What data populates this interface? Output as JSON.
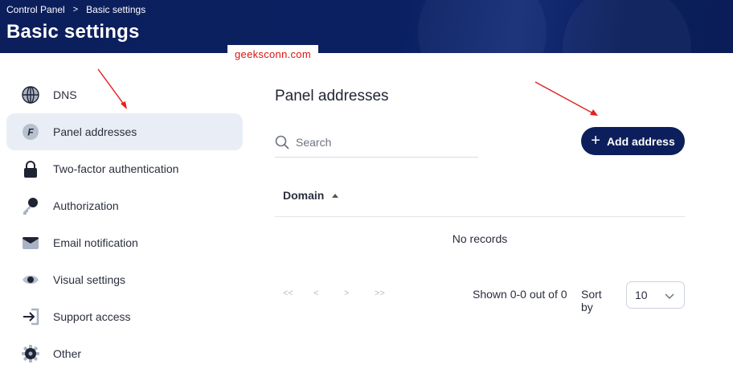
{
  "header": {
    "breadcrumb": [
      "Control Panel",
      "Basic settings"
    ],
    "breadcrumb_separator": ">",
    "title": "Basic settings"
  },
  "watermark": "geeksconn.com",
  "sidebar": {
    "items": [
      {
        "label": "DNS",
        "icon": "globe-icon"
      },
      {
        "label": "Panel addresses",
        "icon": "panel-f-icon",
        "active": true
      },
      {
        "label": "Two-factor authentication",
        "icon": "lock-icon"
      },
      {
        "label": "Authorization",
        "icon": "key-icon"
      },
      {
        "label": "Email notification",
        "icon": "envelope-icon"
      },
      {
        "label": "Visual settings",
        "icon": "eye-icon"
      },
      {
        "label": "Support access",
        "icon": "login-arrow-icon"
      },
      {
        "label": "Other",
        "icon": "gear-icon"
      }
    ]
  },
  "main": {
    "title": "Panel addresses",
    "search_placeholder": "Search",
    "add_button": "Add address",
    "table": {
      "columns": [
        "Domain"
      ],
      "empty_text": "No records"
    },
    "pagination": {
      "first": "<<",
      "prev": "<",
      "next": ">",
      "last": ">>",
      "summary": "Shown 0-0 out of 0",
      "sort_by_label": "Sort by",
      "page_size": "10"
    }
  },
  "colors": {
    "header_bg": "#0c1f5c",
    "button_bg": "#0c1f5c",
    "active_item_bg": "#e9eef6",
    "annotation_arrow": "#e02020"
  }
}
